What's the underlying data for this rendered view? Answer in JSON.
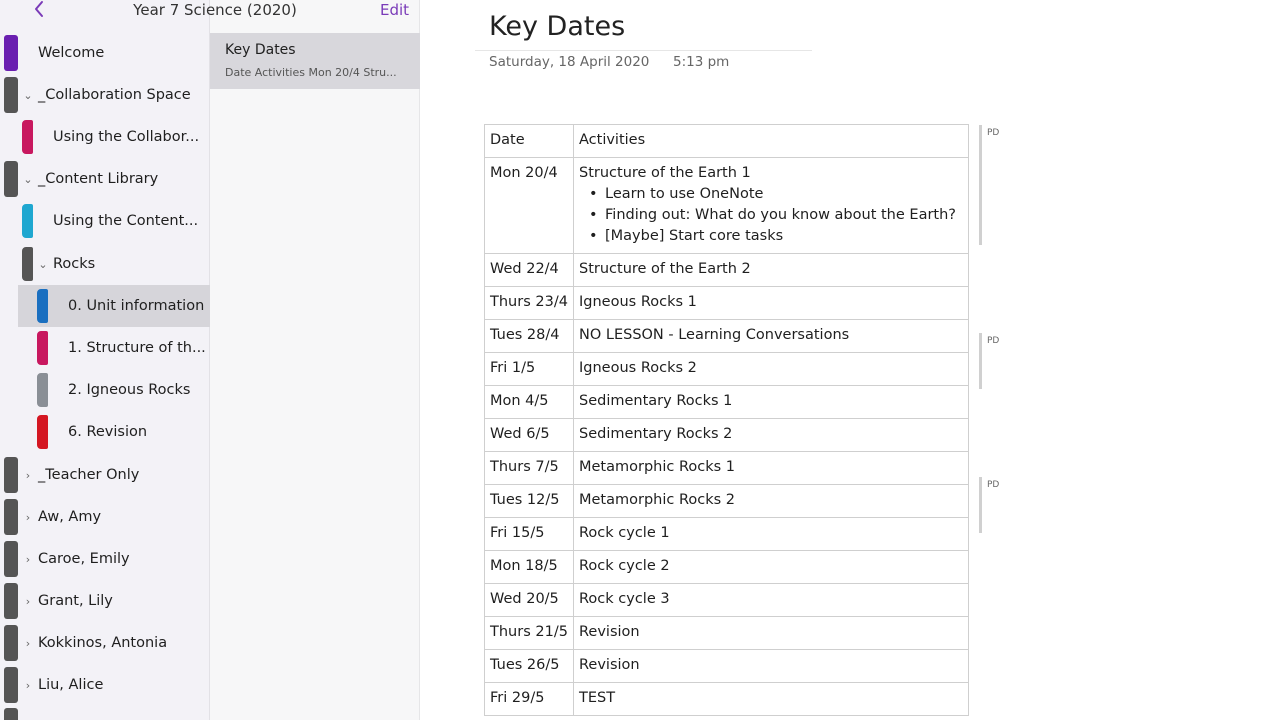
{
  "header": {
    "back_icon": "chevron-left-icon",
    "notebook_title": "Year 7 Science (2020)",
    "edit_label": "Edit"
  },
  "nav": {
    "welcome": "Welcome",
    "collaboration_space": "_Collaboration Space",
    "using_collaboration": "Using the Collabor...",
    "content_library": "_Content Library",
    "using_content": "Using the Content...",
    "rocks": "Rocks",
    "unit_information": "0. Unit information",
    "structure": "1. Structure of th...",
    "igneous": "2. Igneous Rocks",
    "revision": "6. Revision",
    "teacher_only": "_Teacher Only",
    "aw_amy": "Aw, Amy",
    "caroe_emily": "Caroe, Emily",
    "grant_lily": "Grant, Lily",
    "kokkinos_antonia": "Kokkinos, Antonia",
    "liu_alice": "Liu, Alice"
  },
  "colors": {
    "accent": "#7a3bb8",
    "welcome_tab": "#6a1fb0",
    "collab_tab": "#c8185f",
    "content_tab": "#1ea7d0",
    "unit_info_tab": "#1a6fc0",
    "structure_tab": "#c8185f",
    "igneous_tab": "#8a8f96",
    "revision_tab": "#d41622",
    "group_tab": "#555555"
  },
  "pagelist": {
    "title": "Key Dates",
    "preview": "Date  Activities  Mon 20/4  Stru..."
  },
  "page": {
    "title": "Key Dates",
    "date": "Saturday, 18 April 2020",
    "time": "5:13 pm",
    "table": {
      "headers": [
        "Date",
        "Activities"
      ],
      "rows": [
        {
          "date": "Mon 20/4",
          "activity": "Structure of the Earth 1",
          "bullets": [
            "Learn to use OneNote",
            "Finding out: What do you know about the Earth?",
            "[Maybe] Start core tasks"
          ]
        },
        {
          "date": "Wed 22/4",
          "activity": "Structure of the Earth 2"
        },
        {
          "date": "Thurs 23/4",
          "activity": "Igneous Rocks 1"
        },
        {
          "date": "Tues 28/4",
          "activity": "NO LESSON - Learning Conversations"
        },
        {
          "date": "Fri 1/5",
          "activity": "Igneous Rocks 2"
        },
        {
          "date": "Mon 4/5",
          "activity": "Sedimentary Rocks 1"
        },
        {
          "date": "Wed 6/5",
          "activity": "Sedimentary Rocks 2"
        },
        {
          "date": "Thurs 7/5",
          "activity": "Metamorphic Rocks 1"
        },
        {
          "date": "Tues 12/5",
          "activity": "Metamorphic Rocks 2"
        },
        {
          "date": "Fri 15/5",
          "activity": "Rock cycle 1"
        },
        {
          "date": "Mon 18/5",
          "activity": "Rock cycle 2"
        },
        {
          "date": "Wed 20/5",
          "activity": "Rock cycle 3"
        },
        {
          "date": "Thurs 21/5",
          "activity": "Revision"
        },
        {
          "date": "Tues 26/5",
          "activity": "Revision"
        },
        {
          "date": "Fri 29/5",
          "activity": "TEST"
        }
      ]
    },
    "author_tags": [
      "PD",
      "PD",
      "PD"
    ]
  }
}
